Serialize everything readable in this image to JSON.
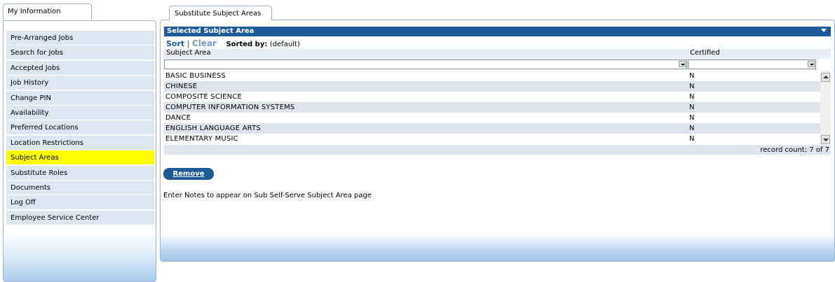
{
  "left_tab": {
    "label": "My Information"
  },
  "menu": [
    {
      "label": "Pre-Arranged Jobs",
      "active": false
    },
    {
      "label": "Search for Jobs",
      "active": false
    },
    {
      "label": "Accepted Jobs",
      "active": false
    },
    {
      "label": "Job History",
      "active": false
    },
    {
      "label": "Change PIN",
      "active": false
    },
    {
      "label": "Availability",
      "active": false
    },
    {
      "label": "Preferred Locations",
      "active": false
    },
    {
      "label": "Location Restrictions",
      "active": false
    },
    {
      "label": "Subject Areas",
      "active": true
    },
    {
      "label": "Substitute Roles",
      "active": false
    },
    {
      "label": "Documents",
      "active": false
    },
    {
      "label": "Log Off",
      "active": false
    },
    {
      "label": "Employee Service Center",
      "active": false
    }
  ],
  "right_tab": {
    "label": "Substitute Subject Areas"
  },
  "section": {
    "title": "Selected Subject Area"
  },
  "sortbar": {
    "sort": "Sort",
    "separator": "|",
    "clear": "Clear",
    "sorted_by_label": "Sorted by:",
    "sorted_by_value": "(default)"
  },
  "columns": {
    "subject_area": "Subject Area",
    "certified": "Certified"
  },
  "rows": [
    {
      "subject": "BASIC BUSINESS",
      "certified": "N"
    },
    {
      "subject": "CHINESE",
      "certified": "N"
    },
    {
      "subject": "COMPOSITE SCIENCE",
      "certified": "N"
    },
    {
      "subject": "COMPUTER INFORMATION SYSTEMS",
      "certified": "N"
    },
    {
      "subject": "DANCE",
      "certified": "N"
    },
    {
      "subject": "ENGLISH LANGUAGE ARTS",
      "certified": "N"
    },
    {
      "subject": "ELEMENTARY MUSIC",
      "certified": "N"
    }
  ],
  "record_count": "record count: 7 of 7",
  "remove_button": "Remove",
  "notes": "Enter Notes to appear on Sub Self-Serve Subject Area page",
  "colors": {
    "accent": "#1e5a96",
    "active_menu": "#ffff00",
    "menu_bg": "#dde7f1",
    "row_alt": "#dde4ec"
  }
}
